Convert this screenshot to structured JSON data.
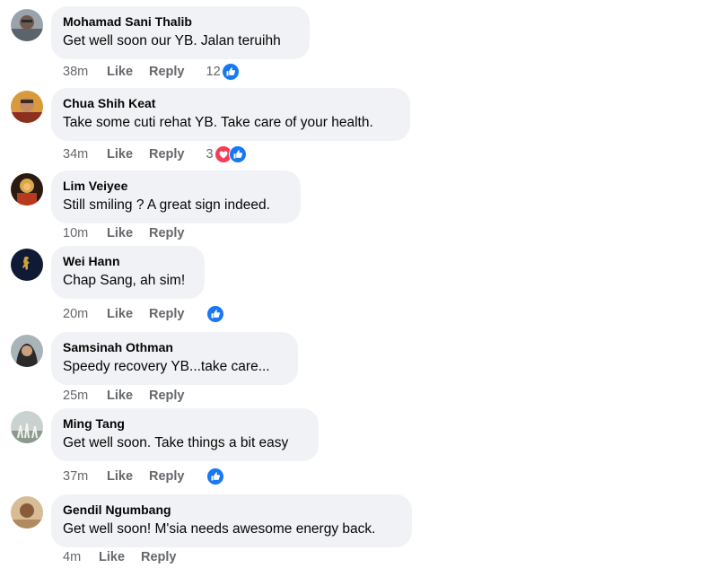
{
  "comments": [
    {
      "name": "Mohamad Sani Thalib",
      "text": "Get well soon our YB. Jalan teruihh",
      "time": "38m",
      "like_label": "Like",
      "reply_label": "Reply",
      "reaction_count": "12",
      "reaction_icons": [
        "like-icon"
      ],
      "colors": {
        "avatar": "#7d8a94"
      }
    },
    {
      "name": "Chua Shih Keat",
      "text": "Take some cuti rehat YB. Take care of your health.",
      "time": "34m",
      "like_label": "Like",
      "reply_label": "Reply",
      "reaction_count": "3",
      "reaction_icons": [
        "love-icon",
        "like-icon"
      ],
      "colors": {
        "avatar": "#b8862e"
      }
    },
    {
      "name": "Lim Veiyee",
      "text": "Still smiling ? A great sign indeed.",
      "time": "10m",
      "like_label": "Like",
      "reply_label": "Reply",
      "reaction_count": "",
      "reaction_icons": [],
      "colors": {
        "avatar": "#9a6a2a"
      }
    },
    {
      "name": "Wei Hann",
      "text": "Chap Sang, ah sim!",
      "time": "20m",
      "like_label": "Like",
      "reply_label": "Reply",
      "reaction_count": "",
      "reaction_icons": [
        "like-icon"
      ],
      "colors": {
        "avatar": "#101a35"
      }
    },
    {
      "name": "Samsinah Othman",
      "text": "Speedy recovery YB...take care...",
      "time": "25m",
      "like_label": "Like",
      "reply_label": "Reply",
      "reaction_count": "",
      "reaction_icons": [],
      "colors": {
        "avatar": "#3c3c3c"
      }
    },
    {
      "name": "Ming Tang",
      "text": "Get well soon. Take things a bit easy",
      "time": "37m",
      "like_label": "Like",
      "reply_label": "Reply",
      "reaction_count": "",
      "reaction_icons": [
        "like-icon"
      ],
      "colors": {
        "avatar": "#8c9ea0"
      }
    },
    {
      "name": "Gendil Ngumbang",
      "text": "Get well soon! M'sia needs awesome energy back.",
      "time": "4m",
      "like_label": "Like",
      "reply_label": "Reply",
      "reaction_count": "",
      "reaction_icons": [],
      "colors": {
        "avatar": "#c8a47a"
      }
    }
  ],
  "colors": {
    "like": "#1877f2",
    "love": "#f33e58",
    "bubble": "#f0f2f5",
    "meta": "#65676b"
  }
}
